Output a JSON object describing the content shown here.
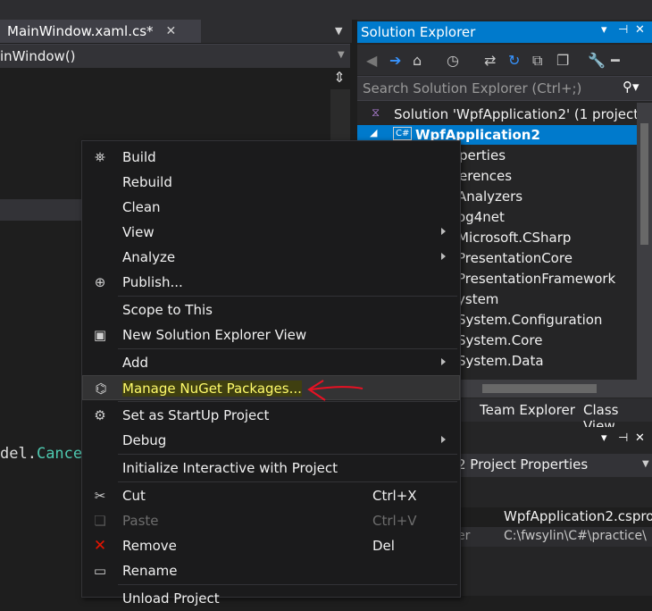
{
  "editor": {
    "tab_title": "MainWindow.xaml.cs*",
    "tab_close": "✕",
    "nav_member": "inWindow()",
    "code_fragment_a": "del.",
    "code_fragment_b": "Cance"
  },
  "solution_explorer": {
    "title": "Solution Explorer",
    "title_buttons": [
      "▾",
      "⊣",
      "✕"
    ],
    "search_placeholder": "Search Solution Explorer (Ctrl+;)",
    "tree": [
      {
        "label": "Solution 'WpfApplication2' (1 project",
        "selected": false
      },
      {
        "label": "WpfApplication2",
        "selected": true
      },
      {
        "label": "perties",
        "selected": false
      },
      {
        "label": "erences",
        "selected": false
      },
      {
        "label": "Analyzers",
        "selected": false
      },
      {
        "label": "og4net",
        "selected": false
      },
      {
        "label": "Microsoft.CSharp",
        "selected": false
      },
      {
        "label": "PresentationCore",
        "selected": false
      },
      {
        "label": "PresentationFramework",
        "selected": false
      },
      {
        "label": "ystem",
        "selected": false
      },
      {
        "label": "System.Configuration",
        "selected": false
      },
      {
        "label": "System.Core",
        "selected": false
      },
      {
        "label": "System.Data",
        "selected": false
      }
    ],
    "bottom_tabs": [
      "Team Explorer",
      "Class View"
    ]
  },
  "properties": {
    "title_buttons": [
      "▾",
      "⊣",
      "✕"
    ],
    "object": "2 Project Properties",
    "rows": [
      {
        "name": "",
        "value": "WpfApplication2.cspro"
      },
      {
        "name": "er",
        "value": "C:\\fwsylin\\C#\\practice\\"
      }
    ]
  },
  "context_menu": {
    "items": [
      {
        "label": "Build",
        "icon": "build-icon",
        "glyph": "⛯",
        "submenu": false
      },
      {
        "label": "Rebuild",
        "icon": "",
        "glyph": "",
        "submenu": false
      },
      {
        "label": "Clean",
        "icon": "",
        "glyph": "",
        "submenu": false
      },
      {
        "label": "View",
        "icon": "",
        "glyph": "",
        "submenu": true
      },
      {
        "label": "Analyze",
        "icon": "",
        "glyph": "",
        "submenu": true
      },
      {
        "label": "Publish...",
        "icon": "globe-icon",
        "glyph": "🌐",
        "submenu": false
      },
      {
        "label": "Scope to This",
        "icon": "",
        "glyph": "",
        "submenu": false
      },
      {
        "label": "New Solution Explorer View",
        "icon": "new-view-icon",
        "glyph": "▣",
        "submenu": false
      },
      {
        "label": "Add",
        "icon": "",
        "glyph": "",
        "submenu": true
      },
      {
        "label": "Manage NuGet Packages...",
        "icon": "nuget-icon",
        "glyph": "⌬",
        "submenu": false
      },
      {
        "label": "Set as StartUp Project",
        "icon": "gear-icon",
        "glyph": "⚙",
        "submenu": false
      },
      {
        "label": "Debug",
        "icon": "",
        "glyph": "",
        "submenu": true
      },
      {
        "label": "Initialize Interactive with Project",
        "icon": "",
        "glyph": "",
        "submenu": false
      },
      {
        "label": "Cut",
        "icon": "scissors-icon",
        "glyph": "✂",
        "shortcut": "Ctrl+X",
        "submenu": false
      },
      {
        "label": "Paste",
        "icon": "paste-icon",
        "glyph": "📋",
        "shortcut": "Ctrl+V",
        "disabled": true,
        "submenu": false
      },
      {
        "label": "Remove",
        "icon": "remove-icon",
        "glyph": "✕",
        "shortcut": "Del",
        "submenu": false
      },
      {
        "label": "Rename",
        "icon": "rename-icon",
        "glyph": "▭",
        "submenu": false
      },
      {
        "label": "Unload Project",
        "icon": "",
        "glyph": "",
        "submenu": false
      }
    ]
  },
  "colors": {
    "accent": "#007acc",
    "highlight_text": "#fffb6b",
    "annotation": "#e81123"
  }
}
